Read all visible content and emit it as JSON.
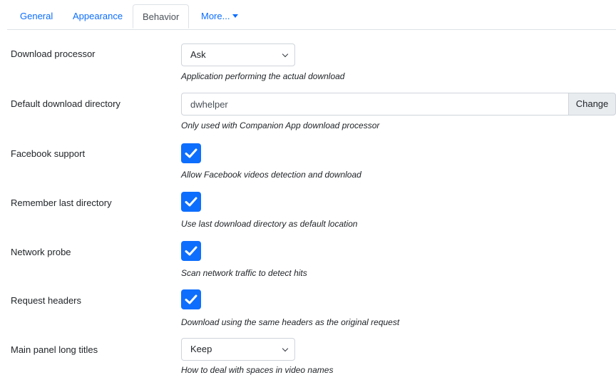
{
  "tabs": [
    {
      "label": "General",
      "active": false
    },
    {
      "label": "Appearance",
      "active": false
    },
    {
      "label": "Behavior",
      "active": true
    },
    {
      "label": "More...",
      "active": false,
      "dropdown": true
    }
  ],
  "colors": {
    "accent": "#0d6efd",
    "button_bg": "#e9ecef",
    "border": "#ced4da"
  },
  "settings": {
    "download_processor": {
      "label": "Download processor",
      "value": "Ask",
      "help": "Application performing the actual download"
    },
    "default_directory": {
      "label": "Default download directory",
      "value": "dwhelper",
      "button": "Change",
      "help": "Only used with Companion App download processor"
    },
    "facebook_support": {
      "label": "Facebook support",
      "checked": true,
      "help": "Allow Facebook videos detection and download"
    },
    "remember_last_directory": {
      "label": "Remember last directory",
      "checked": true,
      "help": "Use last download directory as default location"
    },
    "network_probe": {
      "label": "Network probe",
      "checked": true,
      "help": "Scan network traffic to detect hits"
    },
    "request_headers": {
      "label": "Request headers",
      "checked": true,
      "help": "Download using the same headers as the original request"
    },
    "main_panel_long_titles": {
      "label": "Main panel long titles",
      "value": "Keep",
      "help": "How to deal with spaces in video names"
    }
  }
}
